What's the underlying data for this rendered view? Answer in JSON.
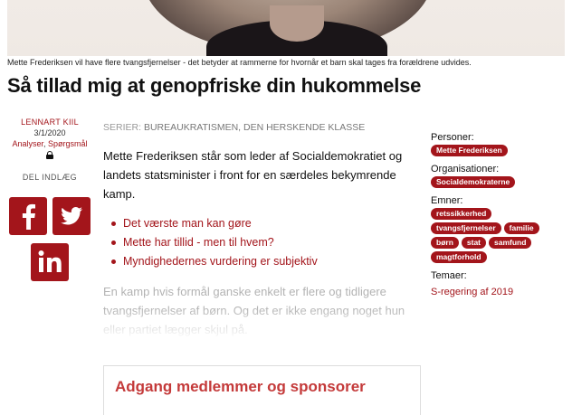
{
  "hero": {
    "image": "portrait-photo"
  },
  "caption": "Mette Frederiksen vil have flere tvangsfjernelser - det betyder at rammerne for hvornår et barn skal tages fra forældrene udvides.",
  "title": "Så tillad mig at genopfriske din hukommelse",
  "meta": {
    "author": "LENNART KIIL",
    "date": "3/1/2020",
    "categories": [
      "Analyser",
      "Spørgsmål"
    ],
    "category_sep": ", ",
    "lock_icon": "lock-icon"
  },
  "share": {
    "label": "DEL INDLÆG",
    "icons": [
      "facebook-icon",
      "twitter-icon",
      "linkedin-icon"
    ]
  },
  "series": {
    "label": "SERIER:",
    "value": "BUREAUKRATISMEN, DEN HERSKENDE KLASSE"
  },
  "lead": "Mette Frederiksen står som leder af Socialdemokratiet og landets statsminister i front for en særdeles bekymrende kamp.",
  "bullets": [
    "Det værste man kan gøre",
    "Mette har tillid - men til hvem?",
    "Myndighedernes vurdering er subjektiv"
  ],
  "body_preview": "En kamp hvis formål ganske enkelt er flere og tidligere tvangsfjernelser af børn. Og det er ikke engang noget hun eller partiet lægger skjul på.",
  "access": {
    "heading": "Adgang medlemmer og sponsorer"
  },
  "sidebar": {
    "persons_label": "Personer:",
    "persons": [
      "Mette Frederiksen"
    ],
    "orgs_label": "Organisationer:",
    "orgs": [
      "Socialdemokraterne"
    ],
    "topics_label": "Emner:",
    "topics": [
      "retssikkerhed",
      "tvangsfjernelser",
      "familie",
      "børn",
      "stat",
      "samfund",
      "magtforhold"
    ],
    "themes_label": "Temaer:",
    "themes": [
      "S-regering af 2019"
    ]
  },
  "colors": {
    "accent": "#a3151b",
    "heading_accent": "#c43a3a",
    "muted": "#999999"
  }
}
